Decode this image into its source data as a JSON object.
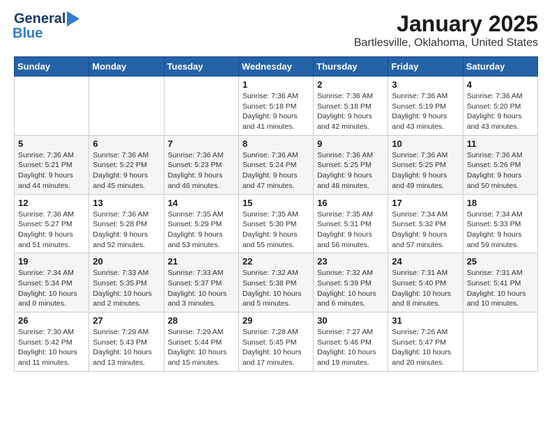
{
  "logo": {
    "general": "General",
    "blue": "Blue"
  },
  "title": "January 2025",
  "subtitle": "Bartlesville, Oklahoma, United States",
  "weekdays": [
    "Sunday",
    "Monday",
    "Tuesday",
    "Wednesday",
    "Thursday",
    "Friday",
    "Saturday"
  ],
  "weeks": [
    [
      {
        "day": "",
        "detail": ""
      },
      {
        "day": "",
        "detail": ""
      },
      {
        "day": "",
        "detail": ""
      },
      {
        "day": "1",
        "detail": "Sunrise: 7:36 AM\nSunset: 5:18 PM\nDaylight: 9 hours\nand 41 minutes."
      },
      {
        "day": "2",
        "detail": "Sunrise: 7:36 AM\nSunset: 5:18 PM\nDaylight: 9 hours\nand 42 minutes."
      },
      {
        "day": "3",
        "detail": "Sunrise: 7:36 AM\nSunset: 5:19 PM\nDaylight: 9 hours\nand 43 minutes."
      },
      {
        "day": "4",
        "detail": "Sunrise: 7:36 AM\nSunset: 5:20 PM\nDaylight: 9 hours\nand 43 minutes."
      }
    ],
    [
      {
        "day": "5",
        "detail": "Sunrise: 7:36 AM\nSunset: 5:21 PM\nDaylight: 9 hours\nand 44 minutes."
      },
      {
        "day": "6",
        "detail": "Sunrise: 7:36 AM\nSunset: 5:22 PM\nDaylight: 9 hours\nand 45 minutes."
      },
      {
        "day": "7",
        "detail": "Sunrise: 7:36 AM\nSunset: 5:23 PM\nDaylight: 9 hours\nand 46 minutes."
      },
      {
        "day": "8",
        "detail": "Sunrise: 7:36 AM\nSunset: 5:24 PM\nDaylight: 9 hours\nand 47 minutes."
      },
      {
        "day": "9",
        "detail": "Sunrise: 7:36 AM\nSunset: 5:25 PM\nDaylight: 9 hours\nand 48 minutes."
      },
      {
        "day": "10",
        "detail": "Sunrise: 7:36 AM\nSunset: 5:25 PM\nDaylight: 9 hours\nand 49 minutes."
      },
      {
        "day": "11",
        "detail": "Sunrise: 7:36 AM\nSunset: 5:26 PM\nDaylight: 9 hours\nand 50 minutes."
      }
    ],
    [
      {
        "day": "12",
        "detail": "Sunrise: 7:36 AM\nSunset: 5:27 PM\nDaylight: 9 hours\nand 51 minutes."
      },
      {
        "day": "13",
        "detail": "Sunrise: 7:36 AM\nSunset: 5:28 PM\nDaylight: 9 hours\nand 52 minutes."
      },
      {
        "day": "14",
        "detail": "Sunrise: 7:35 AM\nSunset: 5:29 PM\nDaylight: 9 hours\nand 53 minutes."
      },
      {
        "day": "15",
        "detail": "Sunrise: 7:35 AM\nSunset: 5:30 PM\nDaylight: 9 hours\nand 55 minutes."
      },
      {
        "day": "16",
        "detail": "Sunrise: 7:35 AM\nSunset: 5:31 PM\nDaylight: 9 hours\nand 56 minutes."
      },
      {
        "day": "17",
        "detail": "Sunrise: 7:34 AM\nSunset: 5:32 PM\nDaylight: 9 hours\nand 57 minutes."
      },
      {
        "day": "18",
        "detail": "Sunrise: 7:34 AM\nSunset: 5:33 PM\nDaylight: 9 hours\nand 59 minutes."
      }
    ],
    [
      {
        "day": "19",
        "detail": "Sunrise: 7:34 AM\nSunset: 5:34 PM\nDaylight: 10 hours\nand 0 minutes."
      },
      {
        "day": "20",
        "detail": "Sunrise: 7:33 AM\nSunset: 5:35 PM\nDaylight: 10 hours\nand 2 minutes."
      },
      {
        "day": "21",
        "detail": "Sunrise: 7:33 AM\nSunset: 5:37 PM\nDaylight: 10 hours\nand 3 minutes."
      },
      {
        "day": "22",
        "detail": "Sunrise: 7:32 AM\nSunset: 5:38 PM\nDaylight: 10 hours\nand 5 minutes."
      },
      {
        "day": "23",
        "detail": "Sunrise: 7:32 AM\nSunset: 5:39 PM\nDaylight: 10 hours\nand 6 minutes."
      },
      {
        "day": "24",
        "detail": "Sunrise: 7:31 AM\nSunset: 5:40 PM\nDaylight: 10 hours\nand 8 minutes."
      },
      {
        "day": "25",
        "detail": "Sunrise: 7:31 AM\nSunset: 5:41 PM\nDaylight: 10 hours\nand 10 minutes."
      }
    ],
    [
      {
        "day": "26",
        "detail": "Sunrise: 7:30 AM\nSunset: 5:42 PM\nDaylight: 10 hours\nand 11 minutes."
      },
      {
        "day": "27",
        "detail": "Sunrise: 7:29 AM\nSunset: 5:43 PM\nDaylight: 10 hours\nand 13 minutes."
      },
      {
        "day": "28",
        "detail": "Sunrise: 7:29 AM\nSunset: 5:44 PM\nDaylight: 10 hours\nand 15 minutes."
      },
      {
        "day": "29",
        "detail": "Sunrise: 7:28 AM\nSunset: 5:45 PM\nDaylight: 10 hours\nand 17 minutes."
      },
      {
        "day": "30",
        "detail": "Sunrise: 7:27 AM\nSunset: 5:46 PM\nDaylight: 10 hours\nand 19 minutes."
      },
      {
        "day": "31",
        "detail": "Sunrise: 7:26 AM\nSunset: 5:47 PM\nDaylight: 10 hours\nand 20 minutes."
      },
      {
        "day": "",
        "detail": ""
      }
    ]
  ]
}
